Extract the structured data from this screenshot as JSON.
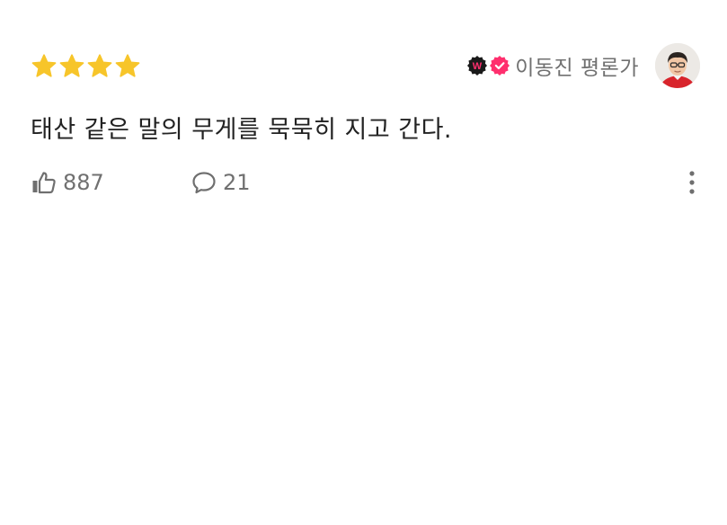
{
  "review": {
    "rating": 4,
    "rating_max": 4,
    "star_color": "#f7c52a",
    "author": {
      "name": "이동진 평론가",
      "badge_primary_icon": "watcha-w-badge-icon",
      "badge_secondary_icon": "verified-check-icon",
      "badge_color": "#ff2f6e"
    },
    "comment": "태산 같은 말의 무게를 묵묵히 지고 간다.",
    "actions": {
      "like_icon": "thumbs-up-icon",
      "likes": "887",
      "comment_icon": "speech-bubble-icon",
      "comments": "21",
      "more_icon": "vertical-dots-icon"
    }
  }
}
